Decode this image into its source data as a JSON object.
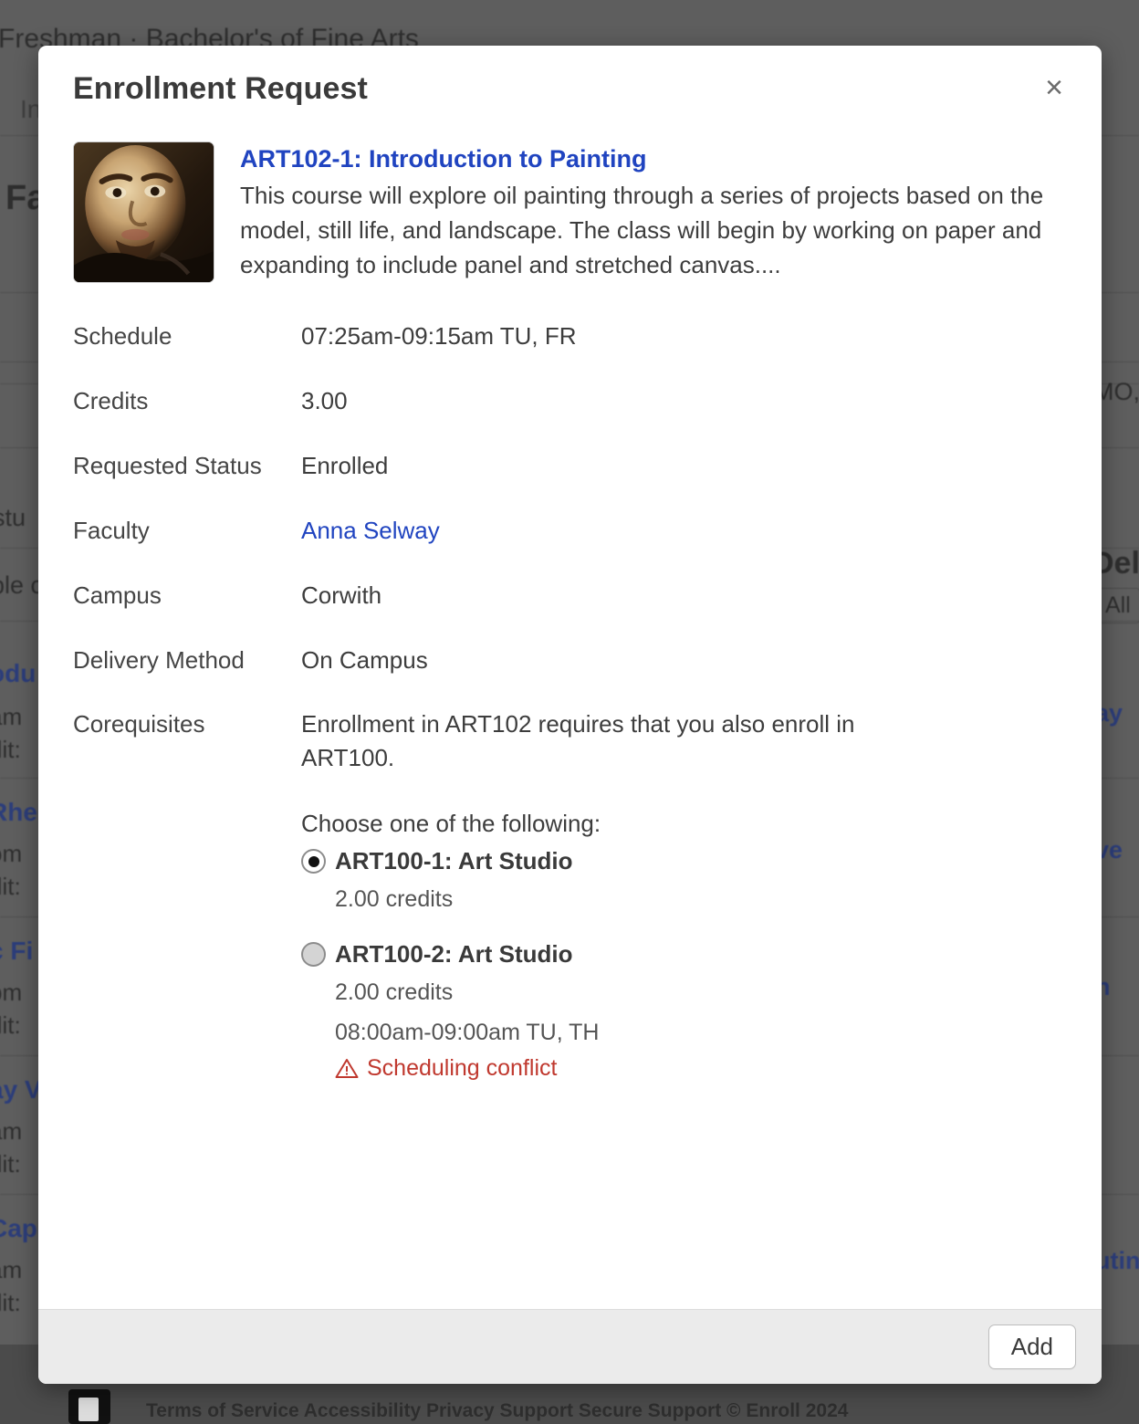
{
  "backdrop": {
    "page_heading": "Freshman · Bachelor's of Fine Arts",
    "sub_heading": "In",
    "section_heading": "Fa",
    "fragment_student": "stu",
    "fragment_available": "ble c",
    "right_fragment_mo": "MO,",
    "right_heading": "Del",
    "right_filter_pill": "All",
    "course_fragments": [
      {
        "title": "odu",
        "time": "am ",
        "credit": "dit: "
      },
      {
        "title": "Rhe",
        "time": "om ",
        "credit": "dit: "
      },
      {
        "title": "c Fi",
        "time": "pm ",
        "credit": "dit: "
      },
      {
        "title": "ay V",
        "time": "am ",
        "credit": "dit: "
      },
      {
        "title": "Cap",
        "time": "am ",
        "credit": "dit: "
      }
    ],
    "right_fragments": [
      "ay",
      "ve",
      "n",
      "utin"
    ],
    "footer_text": "Terms of Service     Accessibility     Privacy     Support     Secure     Support     © Enroll 2024"
  },
  "modal": {
    "title": "Enrollment Request",
    "close_label": "×",
    "course": {
      "title": "ART102-1: Introduction to Painting",
      "description": "This course will explore oil painting through a series of projects based on the model, still life, and landscape. The class will begin by working on paper and expanding to include panel and stretched canvas...."
    },
    "details": [
      {
        "label": "Schedule",
        "value": "07:25am-09:15am TU, FR",
        "link": false
      },
      {
        "label": "Credits",
        "value": "3.00",
        "link": false
      },
      {
        "label": "Requested Status",
        "value": "Enrolled",
        "link": false
      },
      {
        "label": "Faculty",
        "value": "Anna Selway",
        "link": true
      },
      {
        "label": "Campus",
        "value": "Corwith",
        "link": false
      },
      {
        "label": "Delivery Method",
        "value": "On Campus",
        "link": false
      }
    ],
    "corequisites": {
      "label": "Corequisites",
      "text": "Enrollment in ART102 requires that you also enroll in ART100.",
      "choose_label": "Choose one of the following:",
      "options": [
        {
          "name": "ART100-1: Art Studio",
          "credits": "2.00 credits",
          "schedule": "",
          "conflict": "",
          "selected": true
        },
        {
          "name": "ART100-2: Art Studio",
          "credits": "2.00 credits",
          "schedule": "08:00am-09:00am TU, TH",
          "conflict": "Scheduling conflict",
          "selected": false
        }
      ]
    },
    "footer": {
      "add_label": "Add"
    }
  },
  "colors": {
    "link_blue": "#2044c0",
    "conflict_red": "#c0392f",
    "title_gray": "#3a3a3a",
    "footer_bg": "#ebebeb"
  }
}
